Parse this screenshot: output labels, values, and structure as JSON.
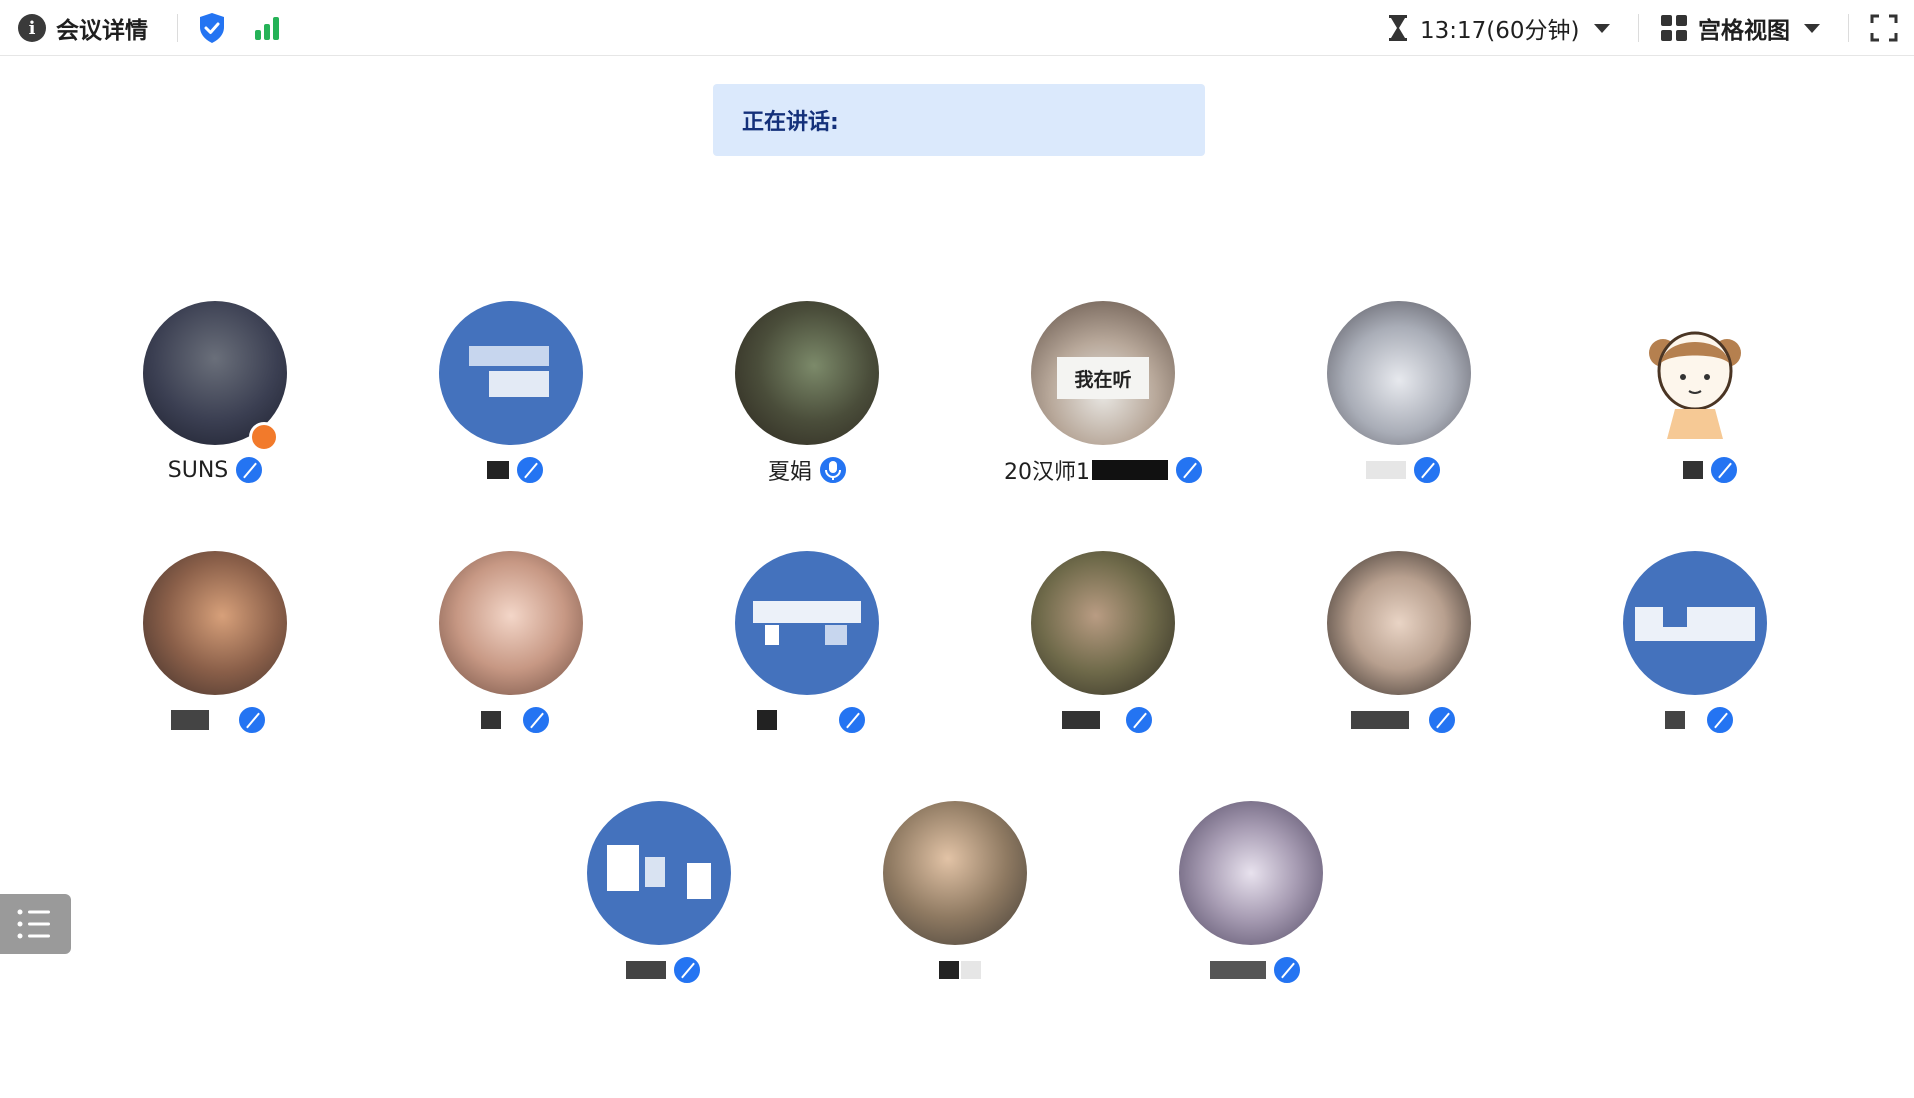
{
  "topbar": {
    "title": "会议详情",
    "info_icon": "info-icon",
    "shield_icon": "shield-check-icon",
    "signal_icon": "signal-bars-icon",
    "timer_icon": "hourglass-icon",
    "timer_text": "13:17(60分钟)",
    "view_icon": "grid-icon",
    "view_label": "宫格视图",
    "fullscreen_icon": "fullscreen-icon"
  },
  "speaking": {
    "label": "正在讲话:"
  },
  "participants": [
    {
      "name": "SUNS",
      "avatar": "photo",
      "host": true,
      "mic": "muted"
    },
    {
      "name": "",
      "avatar": "blue",
      "mic": "muted"
    },
    {
      "name": "夏娟",
      "avatar": "photo",
      "mic": "on"
    },
    {
      "name": "20汉师1",
      "avatar": "photo",
      "avatar_text": "我在听",
      "mic": "muted"
    },
    {
      "name": "",
      "avatar": "photo",
      "mic": "muted"
    },
    {
      "name": "",
      "avatar": "cartoon",
      "mic": "muted"
    },
    {
      "name": "",
      "avatar": "photo",
      "mic": "muted"
    },
    {
      "name": "",
      "avatar": "photo",
      "mic": "muted"
    },
    {
      "name": "",
      "avatar": "blue",
      "mic": "muted"
    },
    {
      "name": "",
      "avatar": "photo",
      "mic": "muted"
    },
    {
      "name": "",
      "avatar": "photo",
      "mic": "muted"
    },
    {
      "name": "",
      "avatar": "blue",
      "mic": "muted"
    },
    {
      "name": "",
      "avatar": "blue",
      "mic": "muted"
    },
    {
      "name": "",
      "avatar": "photo",
      "mic": "none"
    },
    {
      "name": "",
      "avatar": "photo",
      "mic": "muted"
    }
  ],
  "colors": {
    "accent": "#2474f2",
    "avatar_blue": "#4472bd",
    "host_badge": "#f27a2b",
    "banner_bg": "#dbe9fc",
    "signal": "#25b257"
  },
  "side_button": {
    "icon": "list-icon"
  }
}
